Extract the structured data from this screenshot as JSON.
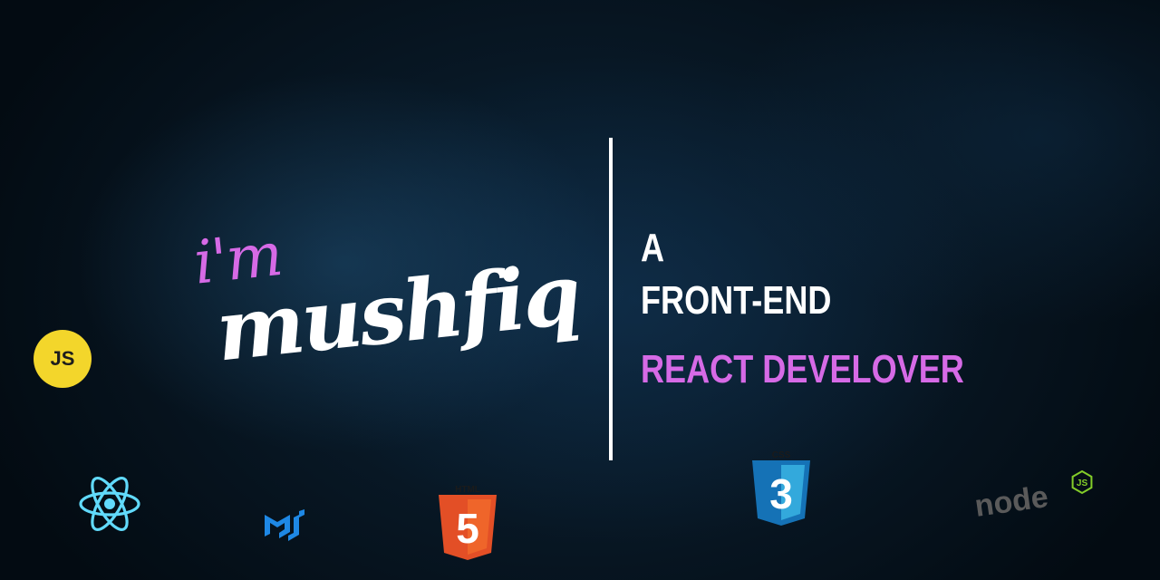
{
  "intro": {
    "greeting": "i'm",
    "name": "mushfiq"
  },
  "tagline": {
    "line1": "A",
    "line2": "FRONT-END",
    "line3": "REACT DEVELOVER"
  },
  "logos": {
    "js_label": "JS",
    "html_label": "HTML",
    "html_number": "5",
    "css_label": "CSS",
    "css_number": "3",
    "node_label": "node",
    "node_badge": "JS"
  },
  "colors": {
    "accent": "#d66ae6",
    "text": "#ffffff",
    "background": "#071521",
    "js_yellow": "#f3d62b",
    "react_blue": "#61dafb",
    "mui_blue": "#1e88e5",
    "html_orange": "#e34f26",
    "css_blue": "#1572b6",
    "node_gray": "#5a5a5a",
    "node_green": "#83cd29"
  },
  "icons": [
    "javascript-icon",
    "react-icon",
    "material-ui-icon",
    "html5-icon",
    "css3-icon",
    "nodejs-icon"
  ]
}
